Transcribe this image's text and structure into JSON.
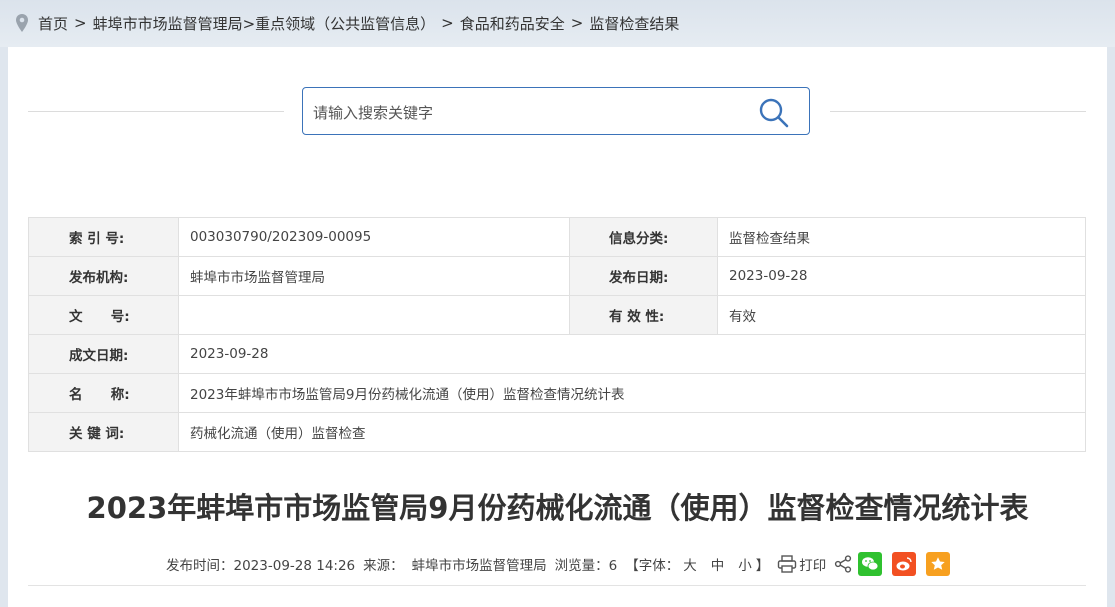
{
  "breadcrumb": {
    "items": [
      "首页",
      ">",
      "蚌埠市市场监督管理局>重点领域（公共监管信息）",
      ">",
      "食品和药品安全",
      ">",
      "监督检查结果"
    ]
  },
  "search": {
    "placeholder": "请输入搜索关键字"
  },
  "meta": {
    "index_label": "索 引 号:",
    "index_value": "003030790/202309-00095",
    "category_label": "信息分类:",
    "category_value": "监督检查结果",
    "publisher_label": "发布机构:",
    "publisher_value": "蚌埠市市场监督管理局",
    "pubdate_label": "发布日期:",
    "pubdate_value": "2023-09-28",
    "docno_label": "文      号:",
    "docno_value": "",
    "validity_label": "有 效 性:",
    "validity_value": "有效",
    "created_label": "成文日期:",
    "created_value": "2023-09-28",
    "name_label": "名      称:",
    "name_value": "2023年蚌埠市市场监管局9月份药械化流通（使用）监督检查情况统计表",
    "keywords_label": "关 键 词:",
    "keywords_value": "药械化流通（使用）监督检查"
  },
  "article": {
    "title": "2023年蚌埠市市场监管局9月份药械化流通（使用）监督检查情况统计表",
    "time_label": "发布时间：2023-09-28 14:26",
    "source_label": "来源：",
    "source_value": "蚌埠市市场监督管理局",
    "views_label": "浏览量：6",
    "font_open": "【字体：",
    "font_large": "大",
    "font_medium": "中",
    "font_small": "小",
    "font_close": "】",
    "print_label": "打印"
  },
  "colors": {
    "search_border": "#3b73b9",
    "wechat": "#2fc12f",
    "weibo": "#f25022",
    "favorite": "#f7a020"
  }
}
